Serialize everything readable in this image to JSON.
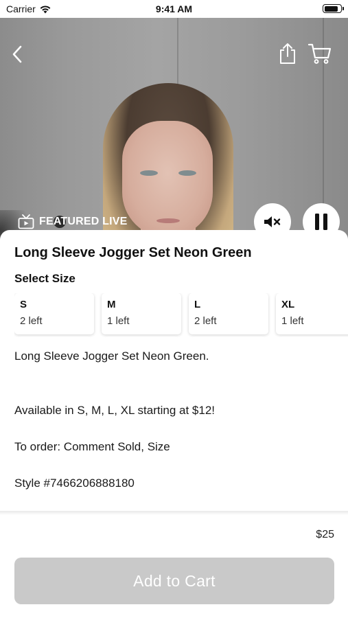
{
  "status_bar": {
    "carrier": "Carrier",
    "time": "9:41 AM",
    "battery_level": 0.9
  },
  "video": {
    "badge_label": "FEATURED LIVE",
    "icons": {
      "back": "chevron-left-icon",
      "share": "share-icon",
      "cart": "cart-icon",
      "mute": "speaker-mute-icon",
      "pause": "pause-icon",
      "live": "tv-icon"
    }
  },
  "product": {
    "title": "Long Sleeve Jogger Set Neon Green",
    "size_heading": "Select Size",
    "sizes": [
      {
        "name": "S",
        "stock": "2 left"
      },
      {
        "name": "M",
        "stock": "1 left"
      },
      {
        "name": "L",
        "stock": "2 left"
      },
      {
        "name": "XL",
        "stock": "1 left"
      }
    ],
    "description": [
      "Long Sleeve Jogger Set Neon Green.",
      "Available in S, M, L, XL starting at $12!",
      "To order: Comment Sold, Size",
      "Style #7466206888180"
    ]
  },
  "footer": {
    "price": "$25",
    "add_to_cart_label": "Add to Cart"
  },
  "colors": {
    "button_disabled": "#c9c9c9",
    "text": "#111111"
  }
}
